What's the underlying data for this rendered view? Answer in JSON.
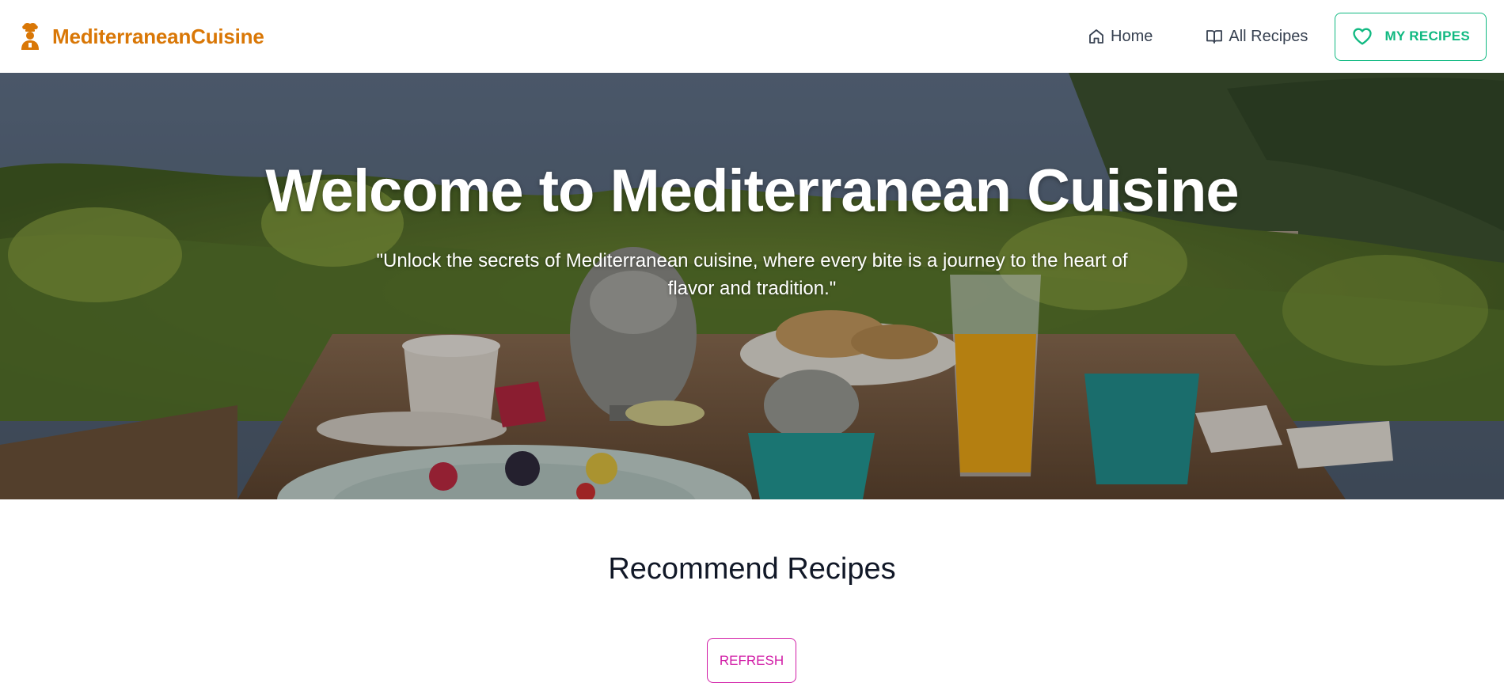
{
  "colors": {
    "brand": "#d97706",
    "accent_teal": "#10b981",
    "refresh_pink": "#d11ca6",
    "nav_text": "#374151",
    "heading": "#111827"
  },
  "navbar": {
    "brand": {
      "icon": "chef-icon",
      "name": "MediterraneanCuisine"
    },
    "links": [
      {
        "icon": "home-icon",
        "label": "Home"
      },
      {
        "icon": "book-open-icon",
        "label": "All Recipes"
      }
    ],
    "my_recipes": {
      "icon": "heart-icon",
      "label": "MY RECIPES"
    }
  },
  "hero": {
    "title": "Welcome to Mediterranean Cuisine",
    "quote": "\"Unlock the secrets of Mediterranean cuisine, where every bite is a journey to the heart of flavor and tradition.\""
  },
  "recommend": {
    "title": "Recommend Recipes",
    "refresh_label": "REFRESH"
  }
}
